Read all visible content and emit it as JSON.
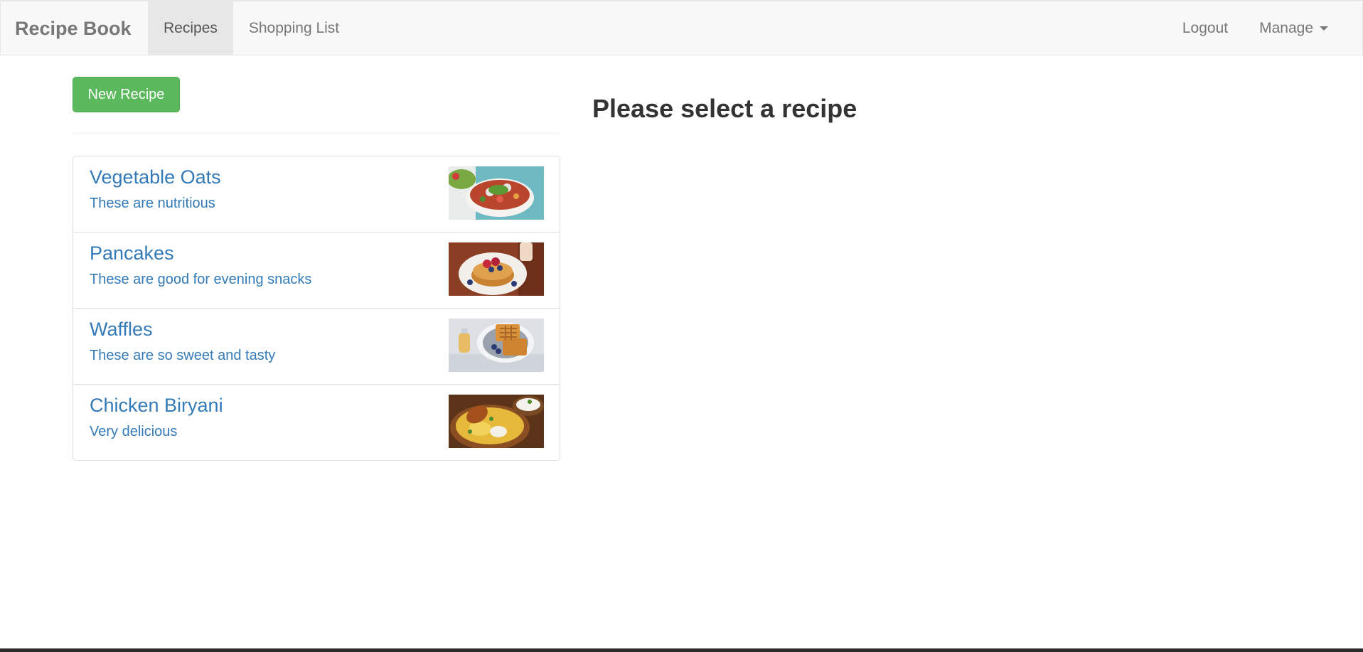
{
  "navbar": {
    "brand": "Recipe Book",
    "left_items": [
      {
        "label": "Recipes",
        "active": true
      },
      {
        "label": "Shopping List",
        "active": false
      }
    ],
    "right_items": {
      "logout": "Logout",
      "manage": "Manage"
    }
  },
  "recipes_panel": {
    "new_button": "New Recipe",
    "items": [
      {
        "name": "Vegetable Oats",
        "description": "These are nutritious",
        "image": "vegetable-oats-photo"
      },
      {
        "name": "Pancakes",
        "description": "These are good for evening snacks",
        "image": "pancakes-photo"
      },
      {
        "name": "Waffles",
        "description": "These are so sweet and tasty",
        "image": "waffles-photo"
      },
      {
        "name": "Chicken Biryani",
        "description": "Very delicious",
        "image": "chicken-biryani-photo"
      }
    ]
  },
  "detail_panel": {
    "placeholder": "Please select a recipe"
  },
  "colors": {
    "success_button": "#5cb85c",
    "link": "#337ab7",
    "navbar_bg": "#f8f8f8",
    "nav_active_bg": "#e7e7e7"
  }
}
